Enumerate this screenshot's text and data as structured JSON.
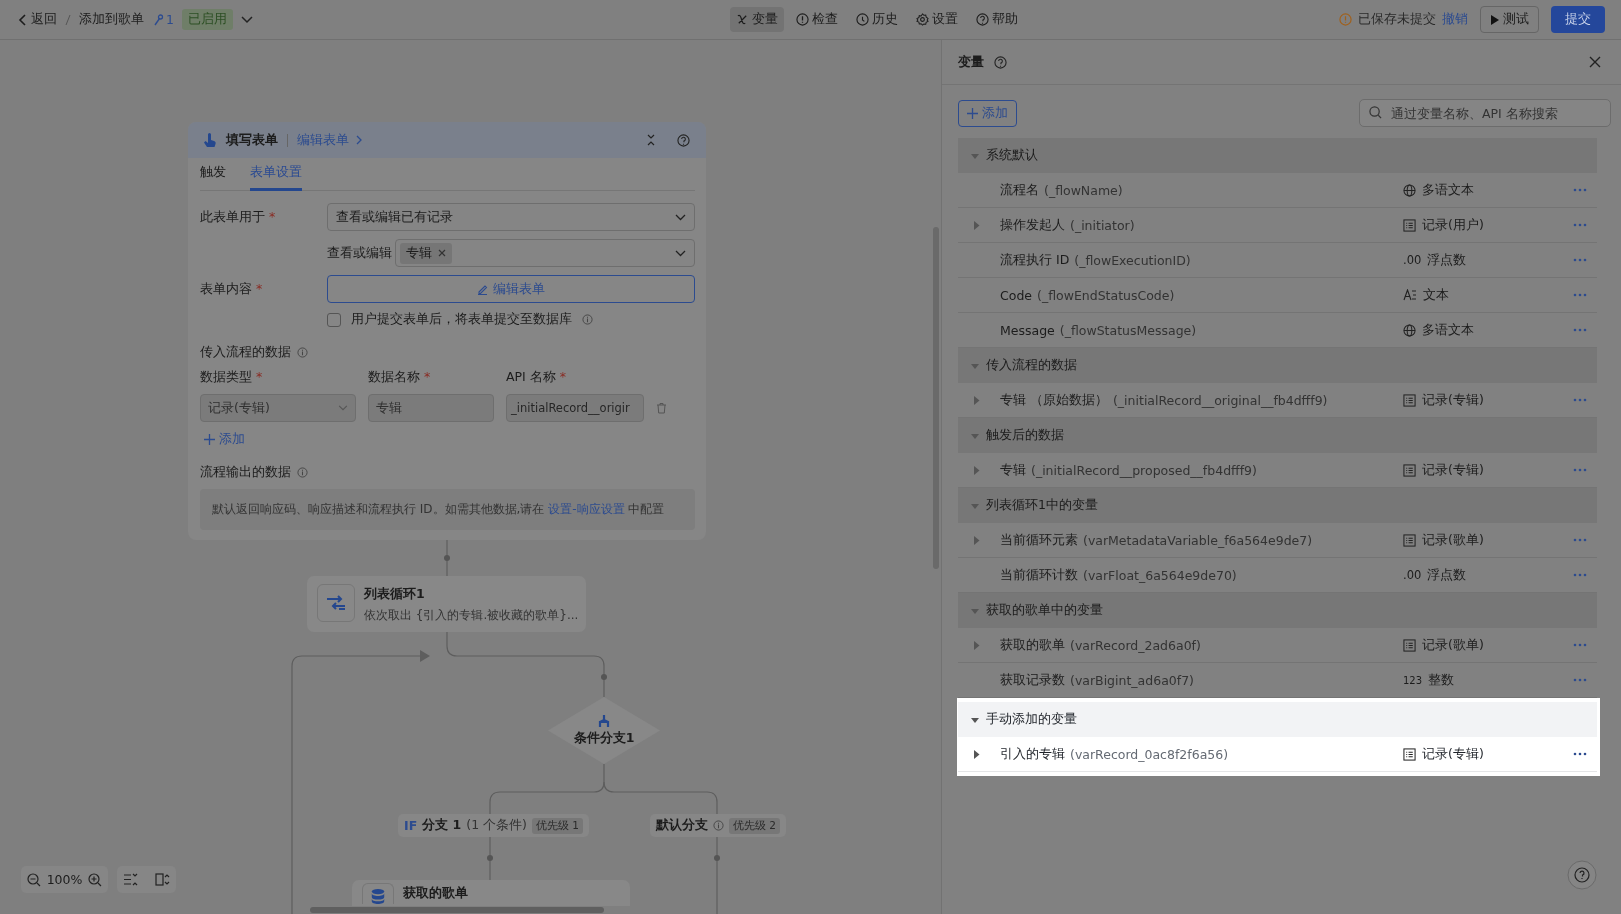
{
  "top_bar": {
    "back": "返回",
    "breadcrumb": "添加到歌单",
    "version": "1",
    "status": "已启用",
    "tools": [
      {
        "label": "变量",
        "selected": true
      },
      {
        "label": "检查",
        "selected": false
      },
      {
        "label": "历史",
        "selected": false
      },
      {
        "label": "设置",
        "selected": false
      },
      {
        "label": "帮助",
        "selected": false
      }
    ],
    "save_status": "已保存未提交",
    "undo": "撤销",
    "test": "测试",
    "submit": "提交"
  },
  "form_node": {
    "title": "填写表单",
    "edit_link": "编辑表单",
    "tabs": [
      {
        "label": "触发",
        "selected": false
      },
      {
        "label": "表单设置",
        "selected": true
      }
    ],
    "purpose": {
      "label": "此表单用于",
      "mark": "*",
      "value": "查看或编辑已有记录"
    },
    "target": {
      "label": "查看或编辑",
      "tags": [
        "专辑"
      ]
    },
    "content": {
      "label": "表单内容",
      "mark": "*",
      "button": "编辑表单"
    },
    "submit_to_db": {
      "label": "用户提交表单后，将表单提交至数据库",
      "checked": false
    },
    "input_section": "传入流程的数据",
    "columns": [
      {
        "label": "数据类型",
        "mark": "*"
      },
      {
        "label": "数据名称",
        "mark": "*"
      },
      {
        "label": "API 名称",
        "mark": "*"
      }
    ],
    "input_row": {
      "type": "记录(专辑)",
      "name": "专辑",
      "api": "_initialRecord__origir"
    },
    "add": "添加",
    "output_section": "流程输出的数据",
    "output_note": "默认返回响应码、响应描述和流程执行 ID。如需其他数据,请在",
    "output_link": "设置-响应设置",
    "output_note_end": "中配置"
  },
  "flow": {
    "loop": {
      "title": "列表循环1",
      "desc": "依次取出 {引入的专辑.被收藏的歌单}..."
    },
    "condition": "条件分支1",
    "branches": [
      {
        "kind": "if",
        "tag": "IF",
        "label": "分支 1",
        "detail": "(1 个条件)",
        "priority": "优先级 1"
      },
      {
        "kind": "default",
        "label": "默认分支",
        "priority": "优先级 2"
      }
    ],
    "fetch": {
      "title": "获取的歌单"
    }
  },
  "zoom": "100%",
  "variables_panel": {
    "title": "变量",
    "add": "添加",
    "search_placeholder": "通过变量名称、API 名称搜索",
    "groups": [
      {
        "title": "系统默认",
        "expanded": true,
        "highlighted": false,
        "items": [
          {
            "name": "流程名",
            "api": "(_flowName)",
            "kind": "multilang",
            "type": "多语文本",
            "expandable": false
          },
          {
            "name": "操作发起人",
            "api": "(_initiator)",
            "kind": "record",
            "type": "记录(用户)",
            "expandable": true
          },
          {
            "name": "流程执行 ID",
            "api": "(_flowExecutionID)",
            "kind": "float",
            "glyph": ".00",
            "type": "浮点数",
            "expandable": false
          },
          {
            "name": "Code",
            "api": "(_flowEndStatusCode)",
            "kind": "text",
            "type": "文本",
            "expandable": false
          },
          {
            "name": "Message",
            "api": "(_flowStatusMessage)",
            "kind": "multilang",
            "type": "多语文本",
            "expandable": false
          }
        ]
      },
      {
        "title": "传入流程的数据",
        "expanded": true,
        "highlighted": false,
        "items": [
          {
            "name": "专辑 （原始数据）",
            "api": "(_initialRecord__original__fb4dfff9)",
            "kind": "record",
            "type": "记录(专辑)",
            "expandable": true
          }
        ]
      },
      {
        "title": "触发后的数据",
        "expanded": true,
        "highlighted": false,
        "items": [
          {
            "name": "专辑",
            "api": "(_initialRecord__proposed__fb4dfff9)",
            "kind": "record",
            "type": "记录(专辑)",
            "expandable": true
          }
        ]
      },
      {
        "title": "列表循环1中的变量",
        "expanded": true,
        "highlighted": false,
        "items": [
          {
            "name": "当前循环元素",
            "api": "(varMetadataVariable_f6a564e9de7)",
            "kind": "record",
            "type": "记录(歌单)",
            "expandable": true
          },
          {
            "name": "当前循环计数",
            "api": "(varFloat_6a564e9de70)",
            "kind": "float",
            "glyph": ".00",
            "type": "浮点数",
            "expandable": false
          }
        ]
      },
      {
        "title": "获取的歌单中的变量",
        "expanded": true,
        "highlighted": false,
        "items": [
          {
            "name": "获取的歌单",
            "api": "(varRecord_2ad6a0f)",
            "kind": "record",
            "type": "记录(歌单)",
            "expandable": true
          },
          {
            "name": "获取记录数",
            "api": "(varBigint_ad6a0f7)",
            "kind": "integer",
            "glyph": "123",
            "type": "整数",
            "expandable": false
          }
        ]
      },
      {
        "title": "手动添加的变量",
        "expanded": true,
        "highlighted": true,
        "items": [
          {
            "name": "引入的专辑",
            "api": "(varRecord_0ac8f2f6a56)",
            "kind": "record",
            "type": "记录(专辑)",
            "expandable": true
          }
        ]
      }
    ]
  }
}
